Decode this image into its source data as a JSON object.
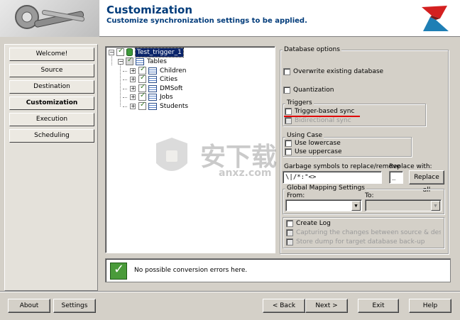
{
  "header": {
    "title": "Customization",
    "subtitle": "Customize synchronization settings to be applied."
  },
  "sidebar": {
    "items": [
      {
        "label": "Welcome!",
        "active": false
      },
      {
        "label": "Source",
        "active": false
      },
      {
        "label": "Destination",
        "active": false
      },
      {
        "label": "Customization",
        "active": true
      },
      {
        "label": "Execution",
        "active": false
      },
      {
        "label": "Scheduling",
        "active": false
      }
    ]
  },
  "tree": {
    "root": "Test_trigger_1",
    "tables_label": "Tables",
    "tables": [
      "Children",
      "Cities",
      "DMSoft",
      "Jobs",
      "Students"
    ]
  },
  "options": {
    "database_options_title": "Database options",
    "overwrite_label": "Overwrite existing database",
    "quantization_label": "Quantization",
    "triggers_title": "Triggers",
    "trigger_based_label": "Trigger-based sync",
    "bidirectional_label": "Bidirectional sync",
    "using_case_title": "Using Case",
    "lowercase_label": "Use lowercase",
    "uppercase_label": "Use uppercase",
    "garbage_label": "Garbage symbols to replace/remove",
    "garbage_value": "\\|/*:\"<>",
    "replace_with_label": "Replace with:",
    "replace_with_value": "_",
    "replace_all_label": "Replace all",
    "global_mapping_title": "Global Mapping Settings",
    "from_label": "From:",
    "to_label": "To:",
    "create_log_label": "Create Log",
    "capturing_label": "Capturing the changes between source & destinatio",
    "store_dump_label": "Store dump for target database back-up"
  },
  "message": {
    "text": "No possible conversion errors here."
  },
  "footer": {
    "about": "About",
    "settings": "Settings",
    "back": "< Back",
    "next": "Next >",
    "exit": "Exit",
    "help": "Help"
  },
  "watermark": {
    "chinese": "安下载",
    "latin": "anxz.com"
  },
  "colors": {
    "title": "#003b7a",
    "background": "#d4d0c8",
    "accent_red": "#e00000",
    "check_green": "#4a9b3a"
  }
}
